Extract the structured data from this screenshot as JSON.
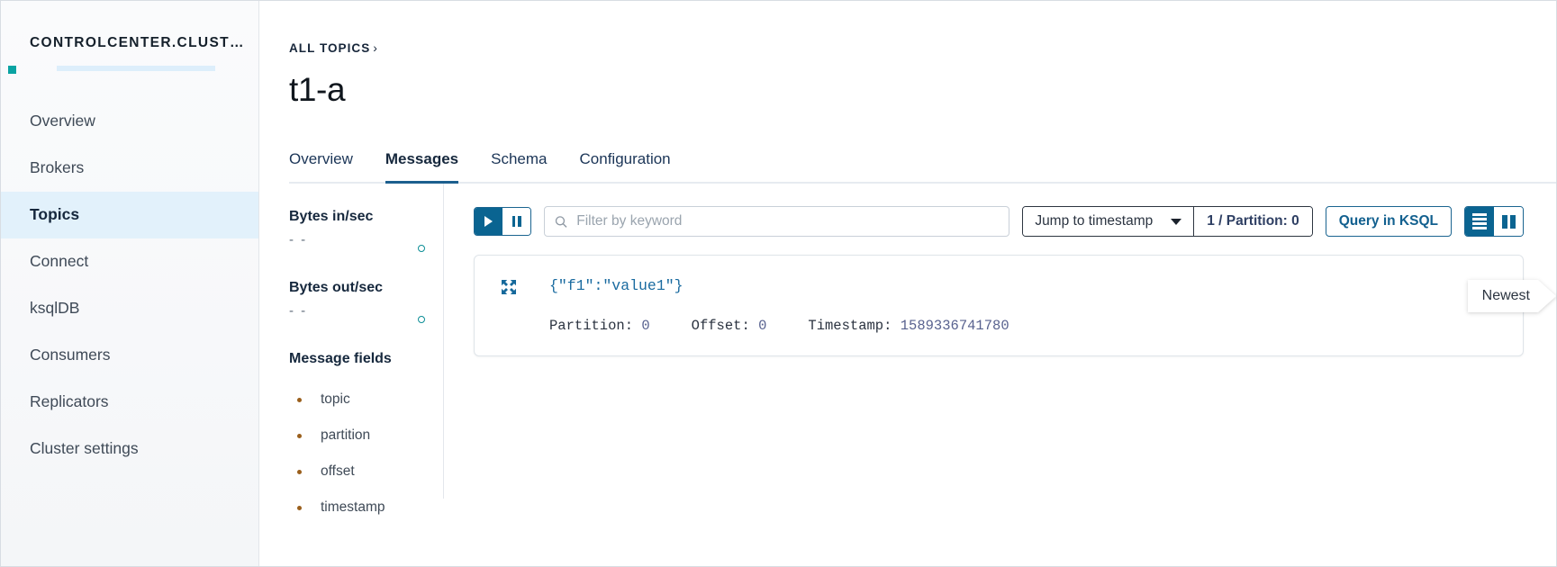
{
  "sidebar": {
    "cluster_name": "CONTROLCENTER.CLUST…",
    "items": [
      {
        "label": "Overview",
        "active": false
      },
      {
        "label": "Brokers",
        "active": false
      },
      {
        "label": "Topics",
        "active": true
      },
      {
        "label": "Connect",
        "active": false
      },
      {
        "label": "ksqlDB",
        "active": false
      },
      {
        "label": "Consumers",
        "active": false
      },
      {
        "label": "Replicators",
        "active": false
      },
      {
        "label": "Cluster settings",
        "active": false
      }
    ],
    "accent_teal": "#0aa3a3",
    "active_bg": "#e2f1fb"
  },
  "header": {
    "breadcrumb": "ALL TOPICS",
    "breadcrumb_chevron": "›",
    "title": "t1-a"
  },
  "tabs": [
    {
      "label": "Overview",
      "active": false
    },
    {
      "label": "Messages",
      "active": true
    },
    {
      "label": "Schema",
      "active": false
    },
    {
      "label": "Configuration",
      "active": false
    }
  ],
  "metrics": [
    {
      "label": "Bytes in/sec",
      "value": "- -",
      "indicator": "circle-icon"
    },
    {
      "label": "Bytes out/sec",
      "value": "- -",
      "indicator": "circle-icon"
    }
  ],
  "message_fields": {
    "title": "Message fields",
    "items": [
      "topic",
      "partition",
      "offset",
      "timestamp"
    ],
    "bullet_color": "#9a5f1c"
  },
  "toolbar": {
    "play_label": "play-icon",
    "pause_label": "pause-icon",
    "search_placeholder": "Filter by keyword",
    "search_value": "",
    "search_icon": "search-icon",
    "jump_select_value": "Jump to timestamp",
    "jump_partition_value": "1 / Partition: 0",
    "ksql_button": "Query in KSQL",
    "view_list_icon": "list-view-icon",
    "view_columns_icon": "column-view-icon",
    "accent_blue": "#0a6491"
  },
  "message": {
    "expand_icon": "expand-icon",
    "payload": "{\"f1\":\"value1\"}",
    "meta": [
      {
        "key": "Partition:",
        "value": "0"
      },
      {
        "key": "Offset:",
        "value": "0"
      },
      {
        "key": "Timestamp:",
        "value": "1589336741780"
      }
    ]
  },
  "tooltip": {
    "newest_label": "Newest"
  }
}
